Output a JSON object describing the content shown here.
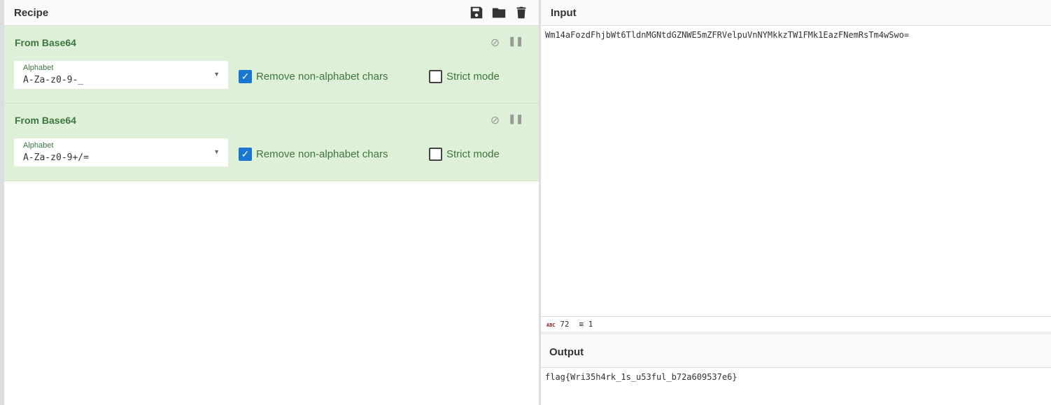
{
  "recipe": {
    "title": "Recipe",
    "operations": [
      {
        "title": "From Base64",
        "alphabet_label": "Alphabet",
        "alphabet": "A-Za-z0-9-_",
        "remove_label": "Remove non-alphabet chars",
        "remove_checked": true,
        "strict_label": "Strict mode",
        "strict_checked": false
      },
      {
        "title": "From Base64",
        "alphabet_label": "Alphabet",
        "alphabet": "A-Za-z0-9+/=",
        "remove_label": "Remove non-alphabet chars",
        "remove_checked": true,
        "strict_label": "Strict mode",
        "strict_checked": false
      }
    ]
  },
  "input": {
    "title": "Input",
    "text": "Wm14aFozdFhjbWt6TldnMGNtdGZNWE5mZFRVelpuVnNYMkkzTW1FMk1EazFNemRsTm4wSwo=",
    "char_count": "72",
    "line_count": "1",
    "abc_icon": "abc"
  },
  "output": {
    "title": "Output",
    "text": "flag{Wri35h4rk_1s_u53ful_b72a609537e6}"
  }
}
